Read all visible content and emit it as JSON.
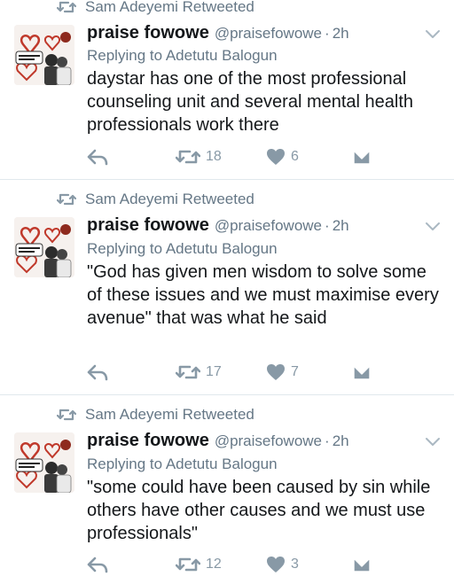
{
  "tweets": [
    {
      "retweeted_by": "Sam Adeyemi Retweeted",
      "name": "praise fowowe",
      "handle": "@praisefowowe",
      "dot": "·",
      "time": "2h",
      "replying_to": "Replying to Adetutu Balogun",
      "text": "daystar has one of the most professional counseling unit and several mental health professionals work there",
      "retweets": "18",
      "likes": "6"
    },
    {
      "retweeted_by": "Sam Adeyemi Retweeted",
      "name": "praise fowowe",
      "handle": "@praisefowowe",
      "dot": "·",
      "time": "2h",
      "replying_to": "Replying to Adetutu Balogun",
      "text": "\"God has given men wisdom to solve some of these issues and we must maximise every avenue\" that was what he said",
      "retweets": "17",
      "likes": "7"
    },
    {
      "retweeted_by": "Sam Adeyemi Retweeted",
      "name": "praise fowowe",
      "handle": "@praisefowowe",
      "dot": "·",
      "time": "2h",
      "replying_to": "Replying to Adetutu Balogun",
      "text": "\"some could have been caused by sin while others have other causes and we must use professionals\"",
      "retweets": "12",
      "likes": "3"
    }
  ],
  "icons": {
    "retweet": "retweet-icon",
    "reply": "reply-icon",
    "like": "heart-icon",
    "dm": "envelope-icon",
    "more": "chevron-down-icon"
  },
  "colors": {
    "text": "#14171a",
    "secondary": "#657786",
    "action": "#8899a6",
    "divider": "#e1e8ed"
  }
}
